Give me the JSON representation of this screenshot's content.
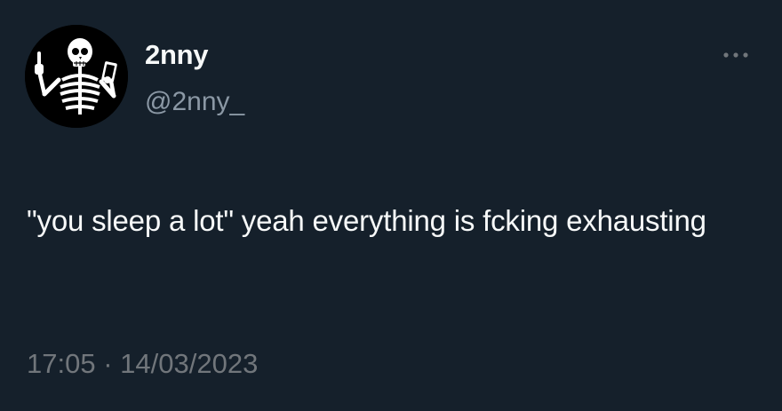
{
  "tweet": {
    "author": {
      "display_name": "2nny",
      "handle": "@2nny_",
      "avatar_icon": "skeleton-icon"
    },
    "more_icon": "more-horizontal-icon",
    "text": "\"you sleep a lot\" yeah everything is fcking exhausting",
    "time": "17:05",
    "separator": "·",
    "date": "14/03/2023"
  },
  "colors": {
    "background": "#15202b",
    "text_primary": "#f7f9f9",
    "text_secondary": "#8b98a5",
    "text_muted": "#71767b"
  }
}
